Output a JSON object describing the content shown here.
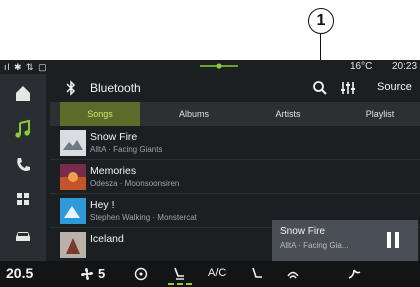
{
  "callout": {
    "number": "1"
  },
  "status_bar": {
    "left_icons": "ıl ✱ ⇅ ▢",
    "temperature": "16°C",
    "time": "20:23"
  },
  "header": {
    "title": "Bluetooth",
    "source_label": "Source"
  },
  "tabs": [
    {
      "label": "Songs",
      "active": true
    },
    {
      "label": "Albums",
      "active": false
    },
    {
      "label": "Artists",
      "active": false
    },
    {
      "label": "Playlist",
      "active": false
    }
  ],
  "songs": [
    {
      "title": "Snow Fire",
      "subtitle": "AlltA · Facing Giants"
    },
    {
      "title": "Memories",
      "subtitle": "Odesza · Moonsoonsiren"
    },
    {
      "title": "Hey !",
      "subtitle": "Stephen Walking · Monstercat"
    },
    {
      "title": "Iceland",
      "subtitle": ""
    }
  ],
  "now_playing": {
    "title": "Snow Fire",
    "subtitle": "AlltA · Facing Gia..."
  },
  "climate_bar": {
    "temperature": "20.5",
    "fan": "5",
    "ac_label": "A/C"
  },
  "colors": {
    "accent": "#8acb3a",
    "background": "#1c1f22",
    "sidebar": "#2a2e33"
  }
}
